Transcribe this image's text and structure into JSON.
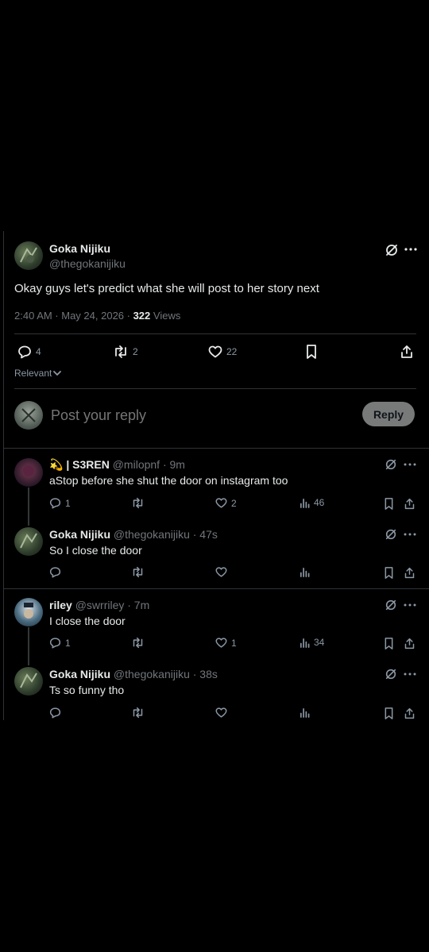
{
  "main_tweet": {
    "author_name": "Goka Nijiku",
    "handle": "@thegokanijiku",
    "text": "Okay guys let's predict what she will post to her story next",
    "time": "2:40 AM · May 24, 2026 · ",
    "views_count": "322",
    "views_label": " Views",
    "replies": "4",
    "reposts": "2",
    "likes": "22",
    "sort_label": "Relevant"
  },
  "reply_box": {
    "placeholder": "Post your reply",
    "button": "Reply"
  },
  "replies": [
    {
      "name": "| S3REN",
      "handle": "@milopnf",
      "time": "· 9m",
      "text": "aStop before she shut the door on instagram too",
      "replies": "1",
      "reposts": "",
      "likes": "2",
      "views": "46"
    },
    {
      "name": "Goka Nijiku",
      "handle": "@thegokanijiku",
      "time": "· 47s",
      "text": "So I close the door",
      "replies": "",
      "reposts": "",
      "likes": "",
      "views": ""
    },
    {
      "name": "riley",
      "handle": "@swrriley",
      "time": "· 7m",
      "text": "I close the door",
      "replies": "1",
      "reposts": "",
      "likes": "1",
      "views": "34"
    },
    {
      "name": "Goka Nijiku",
      "handle": "@thegokanijiku",
      "time": "· 38s",
      "text": "Ts so funny tho",
      "replies": "",
      "reposts": "",
      "likes": "",
      "views": ""
    }
  ]
}
